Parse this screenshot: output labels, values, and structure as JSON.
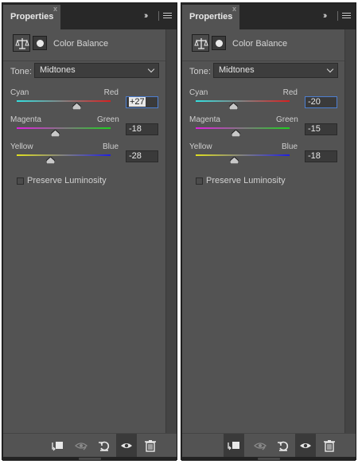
{
  "panels": [
    {
      "tab_label": "Properties",
      "tab_close": "x",
      "collapse_glyph": "››",
      "adjustment_title": "Color Balance",
      "tone_label": "Tone:",
      "tone_value": "Midtones",
      "sliders": [
        {
          "left_label": "Cyan",
          "right_label": "Red",
          "value": "+27",
          "value_num": 27,
          "range": [
            -100,
            100
          ],
          "colors": [
            "#33e0e0",
            "#d82020"
          ]
        },
        {
          "left_label": "Magenta",
          "right_label": "Green",
          "value": "-18",
          "value_num": -18,
          "range": [
            -100,
            100
          ],
          "colors": [
            "#e020e0",
            "#20d020"
          ]
        },
        {
          "left_label": "Yellow",
          "right_label": "Blue",
          "value": "-28",
          "value_num": -28,
          "range": [
            -100,
            100
          ],
          "colors": [
            "#e0e020",
            "#2020e0"
          ]
        }
      ],
      "preserve_label": "Preserve Luminosity",
      "preserve_checked": false,
      "focused_value_index": 0,
      "footer_first_icon": "clip-to-layer-icon"
    },
    {
      "tab_label": "Properties",
      "tab_close": "x",
      "collapse_glyph": "››",
      "adjustment_title": "Color Balance",
      "tone_label": "Tone:",
      "tone_value": "Midtones",
      "sliders": [
        {
          "left_label": "Cyan",
          "right_label": "Red",
          "value": "-20",
          "value_num": -20,
          "range": [
            -100,
            100
          ],
          "colors": [
            "#33e0e0",
            "#d82020"
          ]
        },
        {
          "left_label": "Magenta",
          "right_label": "Green",
          "value": "-15",
          "value_num": -15,
          "range": [
            -100,
            100
          ],
          "colors": [
            "#e020e0",
            "#20d020"
          ]
        },
        {
          "left_label": "Yellow",
          "right_label": "Blue",
          "value": "-18",
          "value_num": -18,
          "range": [
            -100,
            100
          ],
          "colors": [
            "#e0e020",
            "#2020e0"
          ]
        }
      ],
      "preserve_label": "Preserve Luminosity",
      "preserve_checked": false,
      "focused_value_index": 0,
      "footer_first_icon": "clipped-to-layer-icon"
    }
  ],
  "colors": {
    "panel_bg": "#535353",
    "tab_bar_bg": "#282828",
    "focus_ring": "#4d7fd1"
  }
}
